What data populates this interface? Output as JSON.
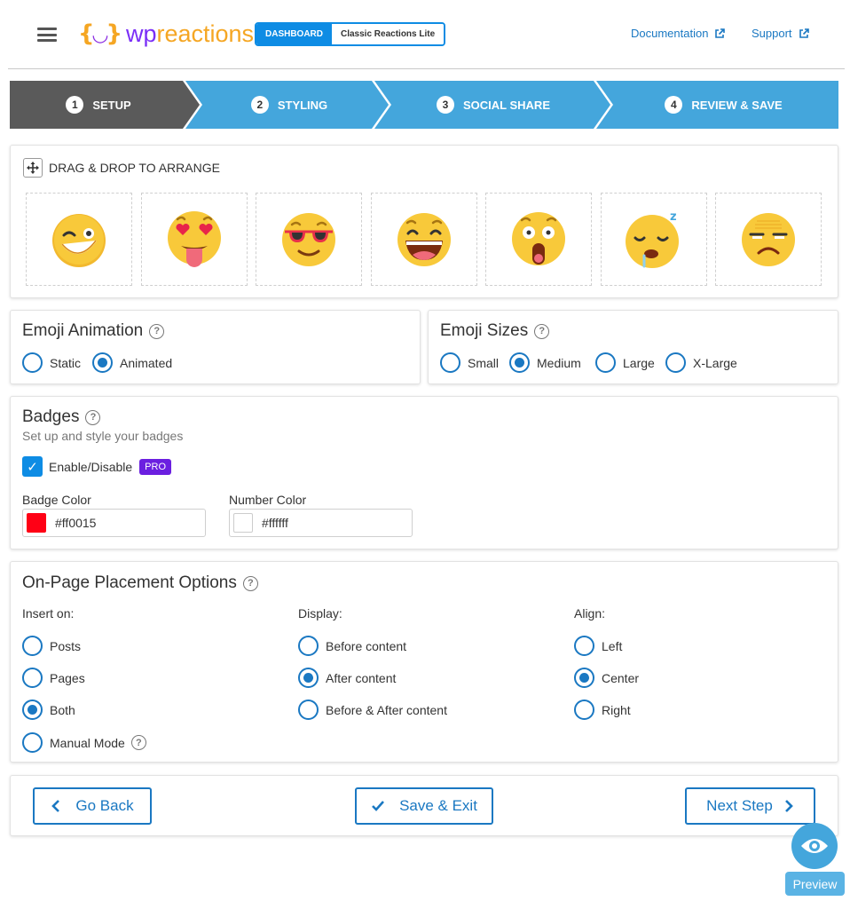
{
  "header": {
    "logo_text_wp": "wp",
    "logo_text_reactions": "reactions",
    "tabs": {
      "dashboard": "DASHBOARD",
      "classic": "Classic Reactions Lite"
    },
    "links": {
      "documentation": "Documentation",
      "support": "Support"
    }
  },
  "steps": [
    {
      "num": "1",
      "label": "SETUP",
      "active": true
    },
    {
      "num": "2",
      "label": "STYLING",
      "active": false
    },
    {
      "num": "3",
      "label": "SOCIAL SHARE",
      "active": false
    },
    {
      "num": "4",
      "label": "REVIEW & SAVE",
      "active": false
    }
  ],
  "drag_drop": {
    "title": "DRAG & DROP TO ARRANGE",
    "emojis": [
      "wink-laugh",
      "heart-eyes-tongue",
      "sunglasses",
      "laughing",
      "shocked",
      "sleeping",
      "unamused"
    ]
  },
  "emoji_animation": {
    "title": "Emoji Animation",
    "options": [
      "Static",
      "Animated"
    ],
    "selected": "Animated"
  },
  "emoji_sizes": {
    "title": "Emoji Sizes",
    "options": [
      "Small",
      "Medium",
      "Large",
      "X-Large"
    ],
    "selected": "Medium"
  },
  "badges": {
    "title": "Badges",
    "subtitle": "Set up and style your badges",
    "enable_label": "Enable/Disable",
    "enabled": true,
    "pro_label": "PRO",
    "badge_color_label": "Badge Color",
    "badge_color_value": "#ff0015",
    "number_color_label": "Number Color",
    "number_color_value": "#ffffff"
  },
  "placement": {
    "title": "On-Page Placement Options",
    "insert_label": "Insert on:",
    "insert_options": [
      "Posts",
      "Pages",
      "Both",
      "Manual Mode"
    ],
    "insert_selected": "Both",
    "display_label": "Display:",
    "display_options": [
      "Before content",
      "After content",
      "Before & After content"
    ],
    "display_selected": "After content",
    "align_label": "Align:",
    "align_options": [
      "Left",
      "Center",
      "Right"
    ],
    "align_selected": "Center"
  },
  "footer": {
    "back": "Go Back",
    "save": "Save & Exit",
    "next": "Next Step"
  },
  "preview_label": "Preview",
  "colors": {
    "primary": "#1a78c2",
    "step_active": "#5a5a5a",
    "step_inactive": "#44a6dc",
    "pro": "#6b1fe0",
    "badge": "#ff0015"
  }
}
